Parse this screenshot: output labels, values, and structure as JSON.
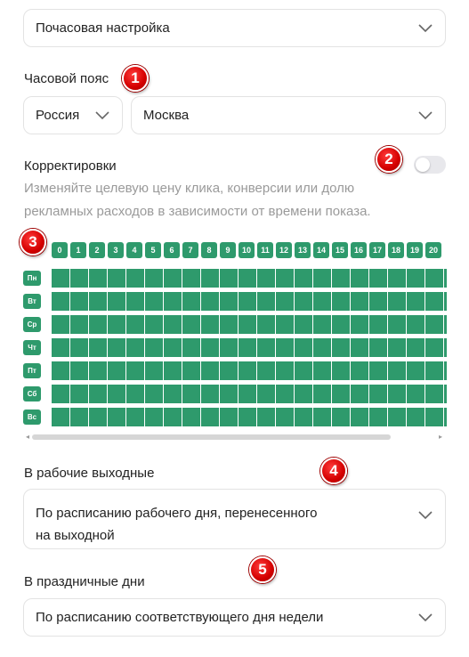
{
  "hourly_select": {
    "value": "Почасовая настройка"
  },
  "timezone": {
    "label": "Часовой пояс",
    "country": "Россия",
    "city": "Москва"
  },
  "corrections": {
    "label": "Корректировки",
    "hint_line1": "Изменяйте целевую цену клика, конверсии или долю",
    "hint_line2": "рекламных расходов в зависимости от времени показа.",
    "toggle_on": false
  },
  "schedule": {
    "hours": [
      "0",
      "1",
      "2",
      "3",
      "4",
      "5",
      "6",
      "7",
      "8",
      "9",
      "10",
      "11",
      "12",
      "13",
      "14",
      "15",
      "16",
      "17",
      "18",
      "19",
      "20"
    ],
    "days": [
      "Пн",
      "Вт",
      "Ср",
      "Чт",
      "Пт",
      "Сб",
      "Вс"
    ],
    "cell_color": "#2e9a6c"
  },
  "working_weekends": {
    "label": "В рабочие выходные",
    "value_line1": "По расписанию рабочего дня, перенесенного",
    "value_line2": "на выходной"
  },
  "holidays": {
    "label": "В праздничные дни",
    "value": "По расписанию соответствующего дня недели"
  },
  "markers": [
    "1",
    "2",
    "3",
    "4",
    "5"
  ],
  "colors": {
    "accent_green": "#2e9a6c",
    "marker_red": "#d40000"
  }
}
